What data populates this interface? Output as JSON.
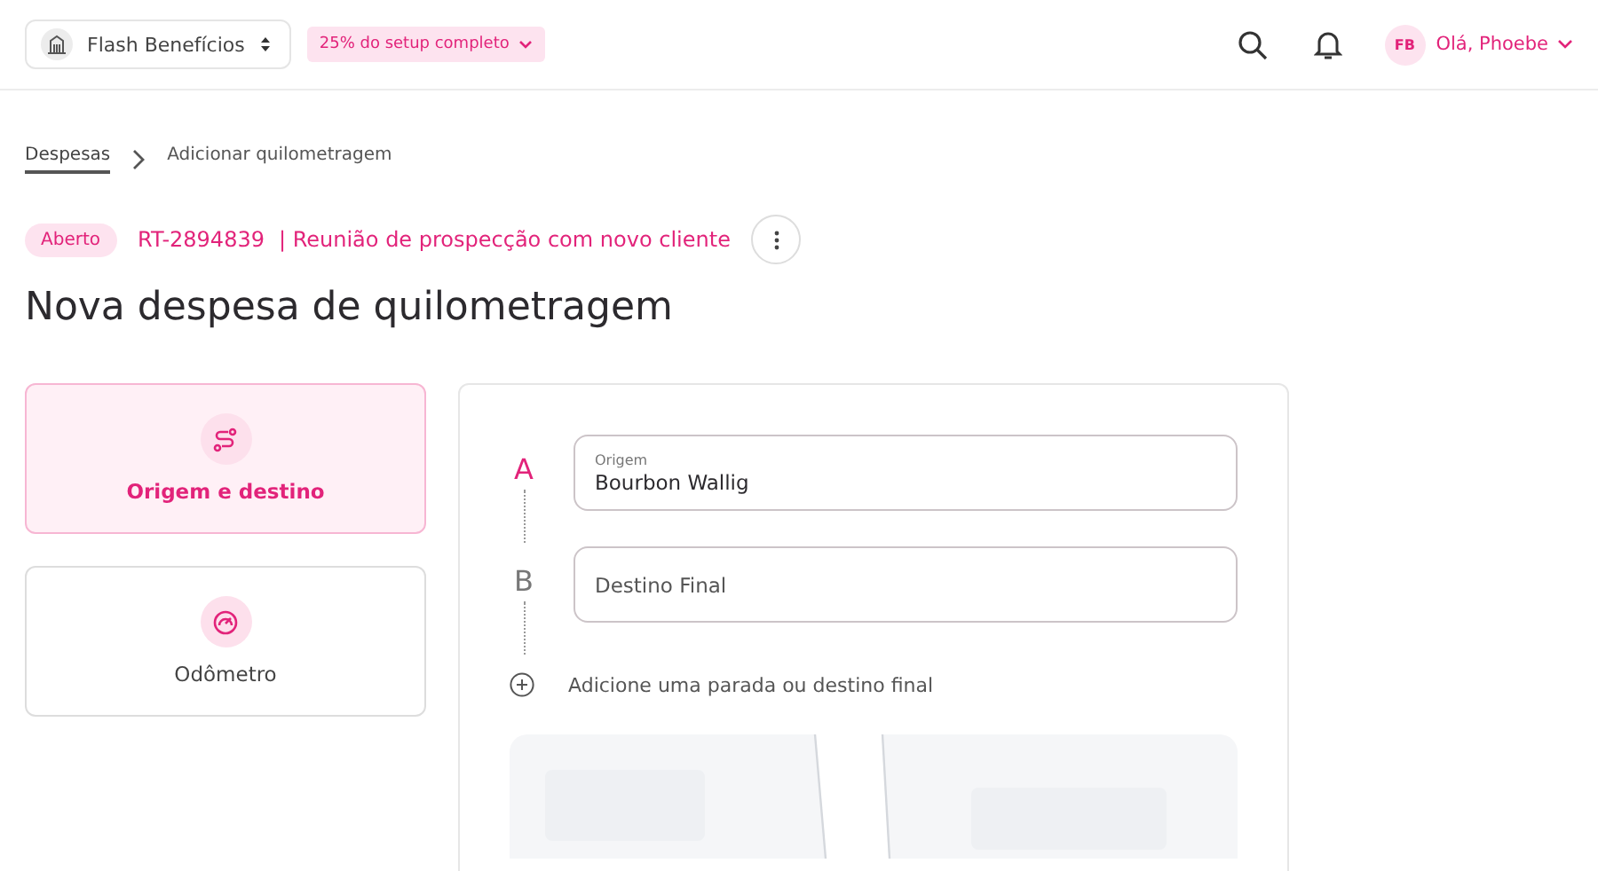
{
  "topbar": {
    "company": "Flash Benefícios",
    "setup_progress": "25% do setup completo",
    "avatar_initials": "FB",
    "greeting": "Olá, Phoebe"
  },
  "breadcrumb": [
    {
      "label": "Despesas",
      "selected": true
    },
    {
      "label": "Adicionar quilometragem",
      "selected": false
    }
  ],
  "report": {
    "status": "Aberto",
    "code": "RT-2894839",
    "title": "| Reunião de prospecção com novo cliente"
  },
  "page_title": "Nova despesa de quilometragem",
  "modes": [
    {
      "label": "Origem e destino",
      "kind": "route",
      "selected": true
    },
    {
      "label": "Odômetro",
      "kind": "odometer",
      "selected": false
    }
  ],
  "stops": [
    {
      "letter": "A",
      "label": "Origem",
      "value": "Bourbon Wallig",
      "active": true
    },
    {
      "letter": "B",
      "placeholder": "Destino Final",
      "active": false
    }
  ],
  "add_stop": "Adicione uma parada ou destino final"
}
